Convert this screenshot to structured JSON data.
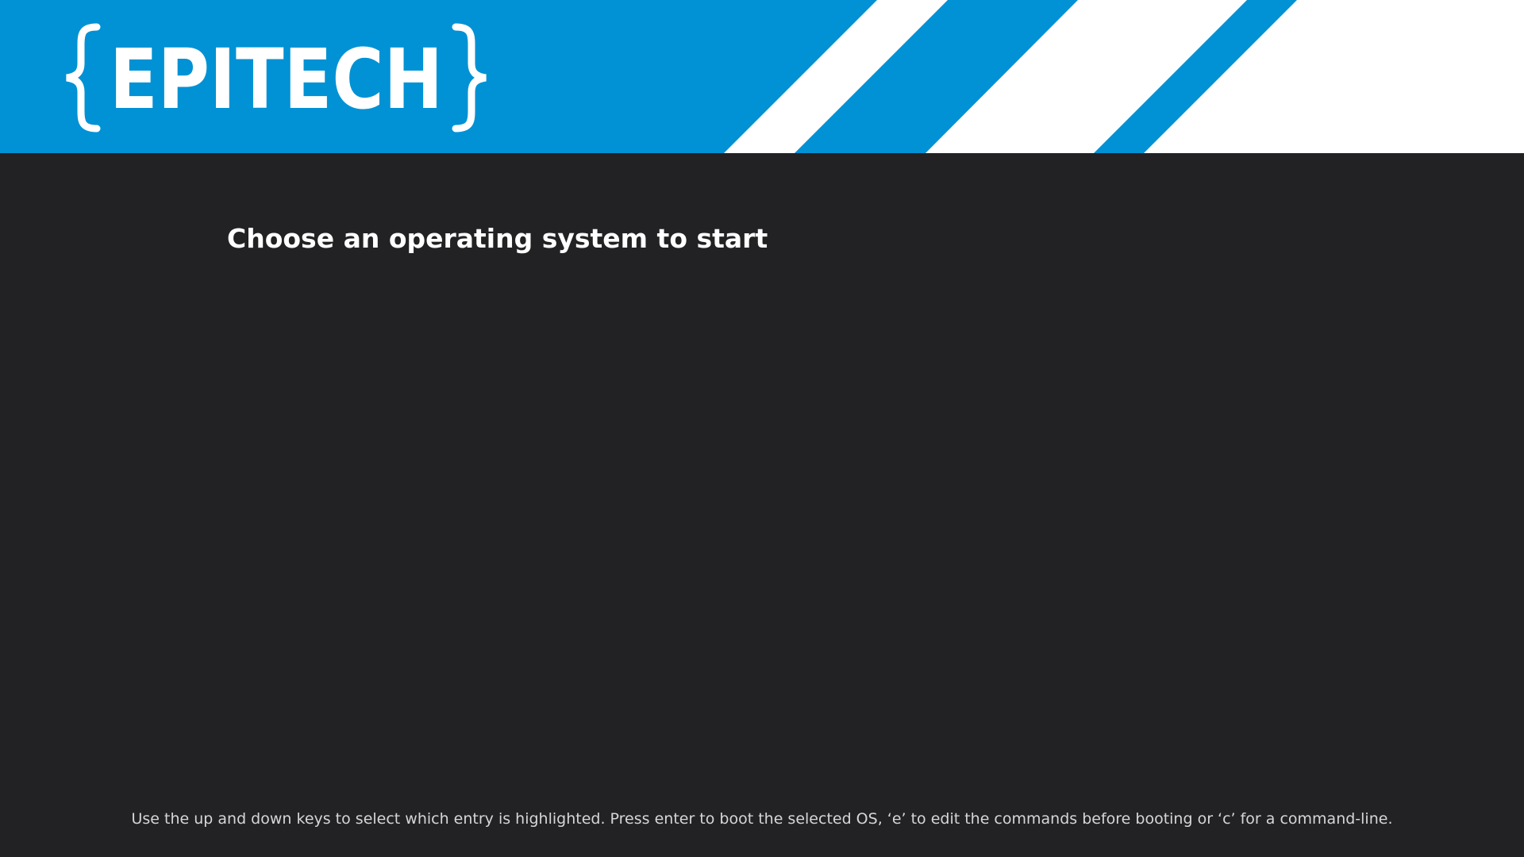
{
  "header": {
    "logo_text": "EPITECH",
    "brand_color": "#0092d4",
    "stripe_color": "#ffffff"
  },
  "menu": {
    "title": "Choose an operating system to start",
    "entries": []
  },
  "footer": {
    "help_text": "Use the up and down keys to select which entry is highlighted. Press enter to boot the selected OS, ‘e’ to edit the commands before booting or ‘c’ for a command-line."
  },
  "colors": {
    "background": "#222124",
    "title_text": "#ffffff",
    "help_text": "#d6d6d8"
  }
}
